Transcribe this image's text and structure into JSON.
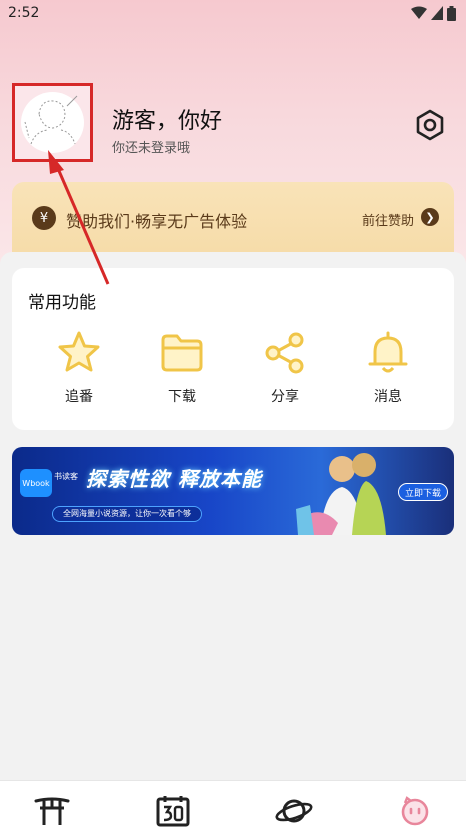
{
  "status_bar": {
    "time": "2:52"
  },
  "profile": {
    "greeting": "游客，你好",
    "subtitle": "你还未登录哦"
  },
  "sponsor": {
    "coin_symbol": "¥",
    "text": "赞助我们·畅享无广告体验",
    "link": "前往赞助",
    "arrow": "❯"
  },
  "features": {
    "title": "常用功能",
    "items": [
      {
        "label": "追番",
        "icon": "star-icon"
      },
      {
        "label": "下载",
        "icon": "folder-icon"
      },
      {
        "label": "分享",
        "icon": "share-icon"
      },
      {
        "label": "消息",
        "icon": "bell-icon"
      }
    ]
  },
  "banner": {
    "logo_text": "Wbook",
    "brand": "书读客",
    "headline": "探索性欲 释放本能",
    "sub": "全网海量小说资源，让你一次看个够",
    "button": "立即下载"
  },
  "bottom_nav": [
    {
      "icon": "torii-gate-icon"
    },
    {
      "icon": "calendar-30-icon"
    },
    {
      "icon": "planet-icon"
    },
    {
      "icon": "profile-face-icon",
      "active": true
    }
  ],
  "colors": {
    "accent": "#f0c548",
    "sponsor_text": "#5a3a1a",
    "active_nav": "#e8869b",
    "annotation": "#d62828"
  }
}
